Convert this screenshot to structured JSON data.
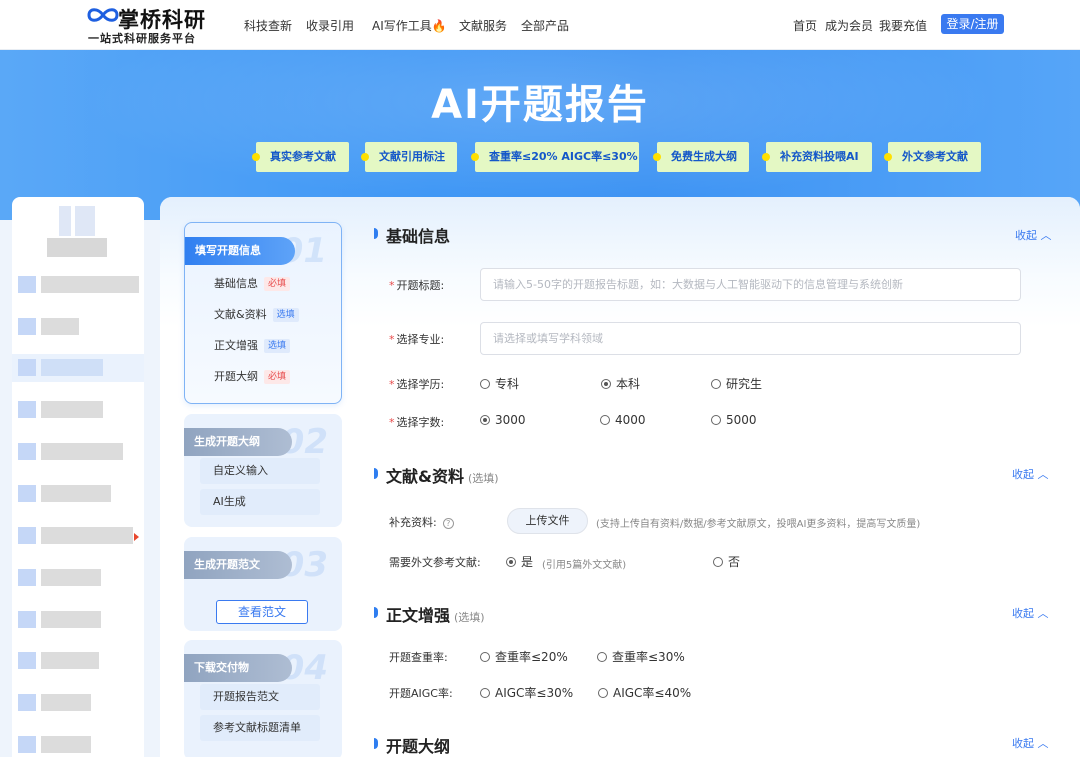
{
  "header": {
    "logo_name": "掌桥科研",
    "logo_slogan": "一站式科研服务平台",
    "nav": [
      "科技查新",
      "收录引用",
      "AI写作工具",
      "文献服务",
      "全部产品"
    ],
    "right_links": [
      "首页",
      "成为会员",
      "我要充值"
    ],
    "login_label": "登录/注册",
    "accent": "#3a7af0"
  },
  "hero": {
    "title": "AI开题报告",
    "tags": [
      "真实参考文献",
      "文献引用标注",
      "查重率≤20% AIGC率≤30%",
      "免费生成大纲",
      "补充资料投喂AI",
      "外文参考文献"
    ]
  },
  "steps": [
    {
      "num": "01",
      "title": "填写开题信息",
      "items": [
        {
          "label": "基础信息",
          "badge": "必填"
        },
        {
          "label": "文献&资料",
          "badge": "选填"
        },
        {
          "label": "正文增强",
          "badge": "选填"
        },
        {
          "label": "开题大纲",
          "badge": "必填"
        }
      ]
    },
    {
      "num": "02",
      "title": "生成开题大纲",
      "items": [
        {
          "label": "自定义输入"
        },
        {
          "label": "AI生成"
        }
      ]
    },
    {
      "num": "03",
      "title": "生成开题范文",
      "button": "查看范文"
    },
    {
      "num": "04",
      "title": "下载交付物",
      "items": [
        {
          "label": "开题报告范文"
        },
        {
          "label": "参考文献标题清单"
        }
      ]
    }
  ],
  "form": {
    "collapse_label": "收起",
    "basic": {
      "title": "基础信息",
      "topic_label": "开题标题:",
      "topic_placeholder": "请输入5-50字的开题报告标题，如：大数据与人工智能驱动下的信息管理与系统创新",
      "major_label": "选择专业:",
      "major_placeholder": "请选择或填写学科领域",
      "degree_label": "选择学历:",
      "degree_options": [
        "专科",
        "本科",
        "研究生"
      ],
      "degree_selected": "本科",
      "words_label": "选择字数:",
      "words_options": [
        "3000",
        "4000",
        "5000"
      ],
      "words_selected": "3000"
    },
    "literature": {
      "title": "文献&资料",
      "optional": "(选填)",
      "supplement_label": "补充资料:",
      "upload_label": "上传文件",
      "upload_hint": "(支持上传自有资料/数据/参考文献原文，投喂AI更多资料，提高写文质量)",
      "foreign_label": "需要外文参考文献:",
      "foreign_yes": "是",
      "foreign_yes_hint": "(引用5篇外文文献)",
      "foreign_no": "否",
      "foreign_selected": "是"
    },
    "enhance": {
      "title": "正文增强",
      "optional": "(选填)",
      "dup_label": "开题查重率:",
      "dup_options": [
        "查重率≤20%",
        "查重率≤30%"
      ],
      "aigc_label": "开题AIGC率:",
      "aigc_options": [
        "AIGC率≤30%",
        "AIGC率≤40%"
      ]
    },
    "outline": {
      "title": "开题大纲"
    }
  }
}
